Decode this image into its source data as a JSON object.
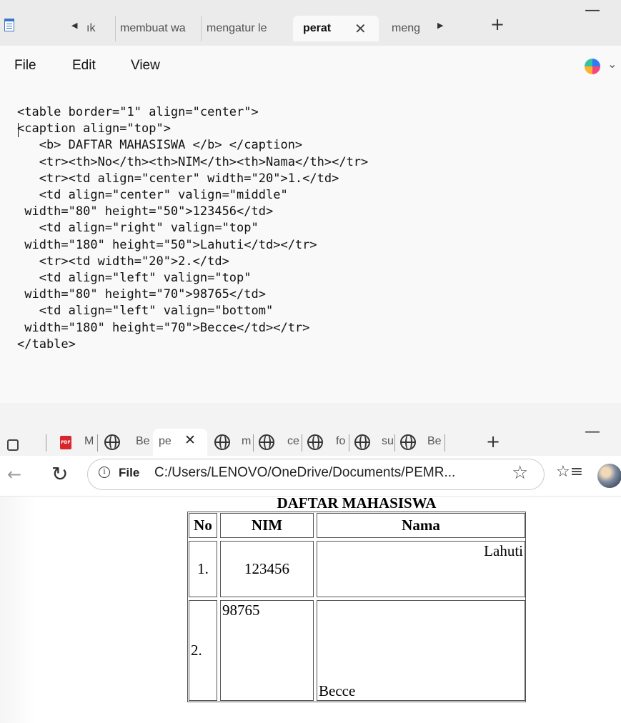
{
  "notepad": {
    "tabs": [
      {
        "label": "ık"
      },
      {
        "label": "membuat wa"
      },
      {
        "label": "mengatur le"
      },
      {
        "label": "perat",
        "active": true
      },
      {
        "label": "meng"
      }
    ],
    "menu": {
      "file": "File",
      "edit": "Edit",
      "view": "View"
    },
    "code_lines": [
      "<table border=\"1\" align=\"center\">",
      "<caption align=\"top\">",
      "   <b> DAFTAR MAHASISWA </b> </caption>",
      "   <tr><th>No</th><th>NIM</th><th>Nama</th></tr>",
      "   <tr><td align=\"center\" width=\"20\">1.</td>",
      "   <td align=\"center\" valign=\"middle\"",
      " width=\"80\" height=\"50\">123456</td>",
      "   <td align=\"right\" valign=\"top\"",
      " width=\"180\" height=\"50\">Lahuti</td></tr>",
      "   <tr><td width=\"20\">2.</td>",
      "   <td align=\"left\" valign=\"top\"",
      " width=\"80\" height=\"70\">98765</td>",
      "   <td align=\"left\" valign=\"bottom\"",
      " width=\"180\" height=\"70\">Becce</td></tr>",
      "</table>"
    ]
  },
  "browser": {
    "tabs": [
      {
        "label": "M"
      },
      {
        "label": "Be"
      },
      {
        "label": "pe",
        "active": true
      },
      {
        "label": "m"
      },
      {
        "label": "ce"
      },
      {
        "label": "fo"
      },
      {
        "label": "su"
      },
      {
        "label": "Be"
      }
    ],
    "address": {
      "scheme_label": "File",
      "url": "C:/Users/LENOVO/OneDrive/Documents/PEMR..."
    },
    "page": {
      "caption": "DAFTAR MAHASISWA",
      "headers": [
        "No",
        "NIM",
        "Nama"
      ],
      "rows": [
        [
          "1.",
          "123456",
          "Lahuti"
        ],
        [
          "2.",
          "98765",
          "Becce"
        ]
      ]
    }
  }
}
